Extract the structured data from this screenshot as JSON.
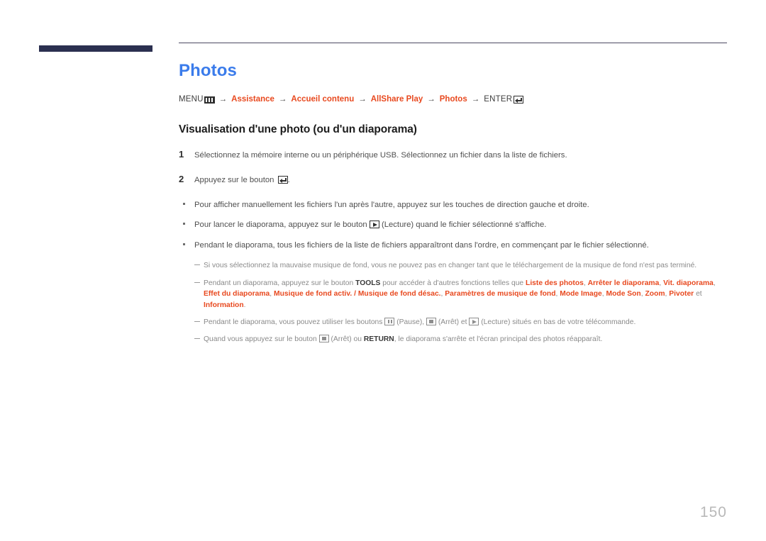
{
  "document": {
    "page_number": "150",
    "title": "Photos",
    "title_color": "#3b7ceb",
    "accent_color": "#e8491f",
    "rule_color": "#4c4a62",
    "corner_bar_color": "#2b3050"
  },
  "breadcrumb": {
    "menu_label": "MENU",
    "menu_icon": "menu-grid-icon",
    "arrow": "→",
    "items": [
      {
        "label": "Assistance",
        "type": "link"
      },
      {
        "label": "Accueil contenu",
        "type": "link"
      },
      {
        "label": "AllShare Play",
        "type": "link"
      },
      {
        "label": "Photos",
        "type": "link"
      }
    ],
    "enter_label": "ENTER",
    "enter_icon": "enter-return-icon"
  },
  "section": {
    "heading": "Visualisation d'une photo (ou d'un diaporama)"
  },
  "steps": [
    {
      "number": "1",
      "text": "Sélectionnez la mémoire interne ou un périphérique USB. Sélectionnez un fichier dans la liste de fichiers."
    },
    {
      "number": "2",
      "text_before": "Appuyez sur le bouton",
      "icon": "enter-return-icon",
      "text_after": "."
    }
  ],
  "bullets": [
    {
      "text": "Pour afficher manuellement les fichiers l'un après l'autre, appuyez sur les touches de direction gauche et droite."
    },
    {
      "text_before": "Pour lancer le diaporama, appuyez sur le bouton",
      "icon": "play-icon",
      "text_after": "(Lecture) quand le fichier sélectionné s'affiche."
    },
    {
      "text": "Pendant le diaporama, tous les fichiers de la liste de fichiers apparaîtront dans l'ordre, en commençant par le fichier sélectionné."
    }
  ],
  "notes": [
    {
      "id": "note-music-download",
      "text": "Si vous sélectionnez la mauvaise musique de fond, vous ne pouvez pas en changer tant que le téléchargement de la musique de fond n'est pas terminé."
    },
    {
      "id": "note-tools",
      "text_before": "Pendant un diaporama, appuyez sur le bouton",
      "bold_key": "TOOLS",
      "text_middle": "pour accéder à d'autres fonctions telles que",
      "options": [
        "Liste des photos",
        "Arrêter le diaporama",
        "Vit. diaporama",
        "Effet du diaporama",
        "Musique de fond activ. / Musique de fond désac.",
        "Paramètres de musique de fond",
        "Mode Image",
        "Mode Son",
        "Zoom",
        "Pivoter"
      ],
      "conjunction": "et",
      "last_option": "Information",
      "text_after": "."
    },
    {
      "id": "note-playback-buttons",
      "text_before": "Pendant le diaporama, vous pouvez utiliser les boutons",
      "icon1": "pause-icon",
      "label1": "(Pause),",
      "icon2": "stop-icon",
      "label2": "(Arrêt) et",
      "icon3": "play-icon",
      "label3": "(Lecture) situés en bas de votre télécommande."
    },
    {
      "id": "note-return",
      "text_before": "Quand vous appuyez sur le bouton",
      "icon": "stop-icon",
      "text_middle": "(Arrêt) ou",
      "bold_key": "RETURN",
      "text_after": ", le diaporama s'arrête et l'écran principal des photos réapparaît."
    }
  ]
}
